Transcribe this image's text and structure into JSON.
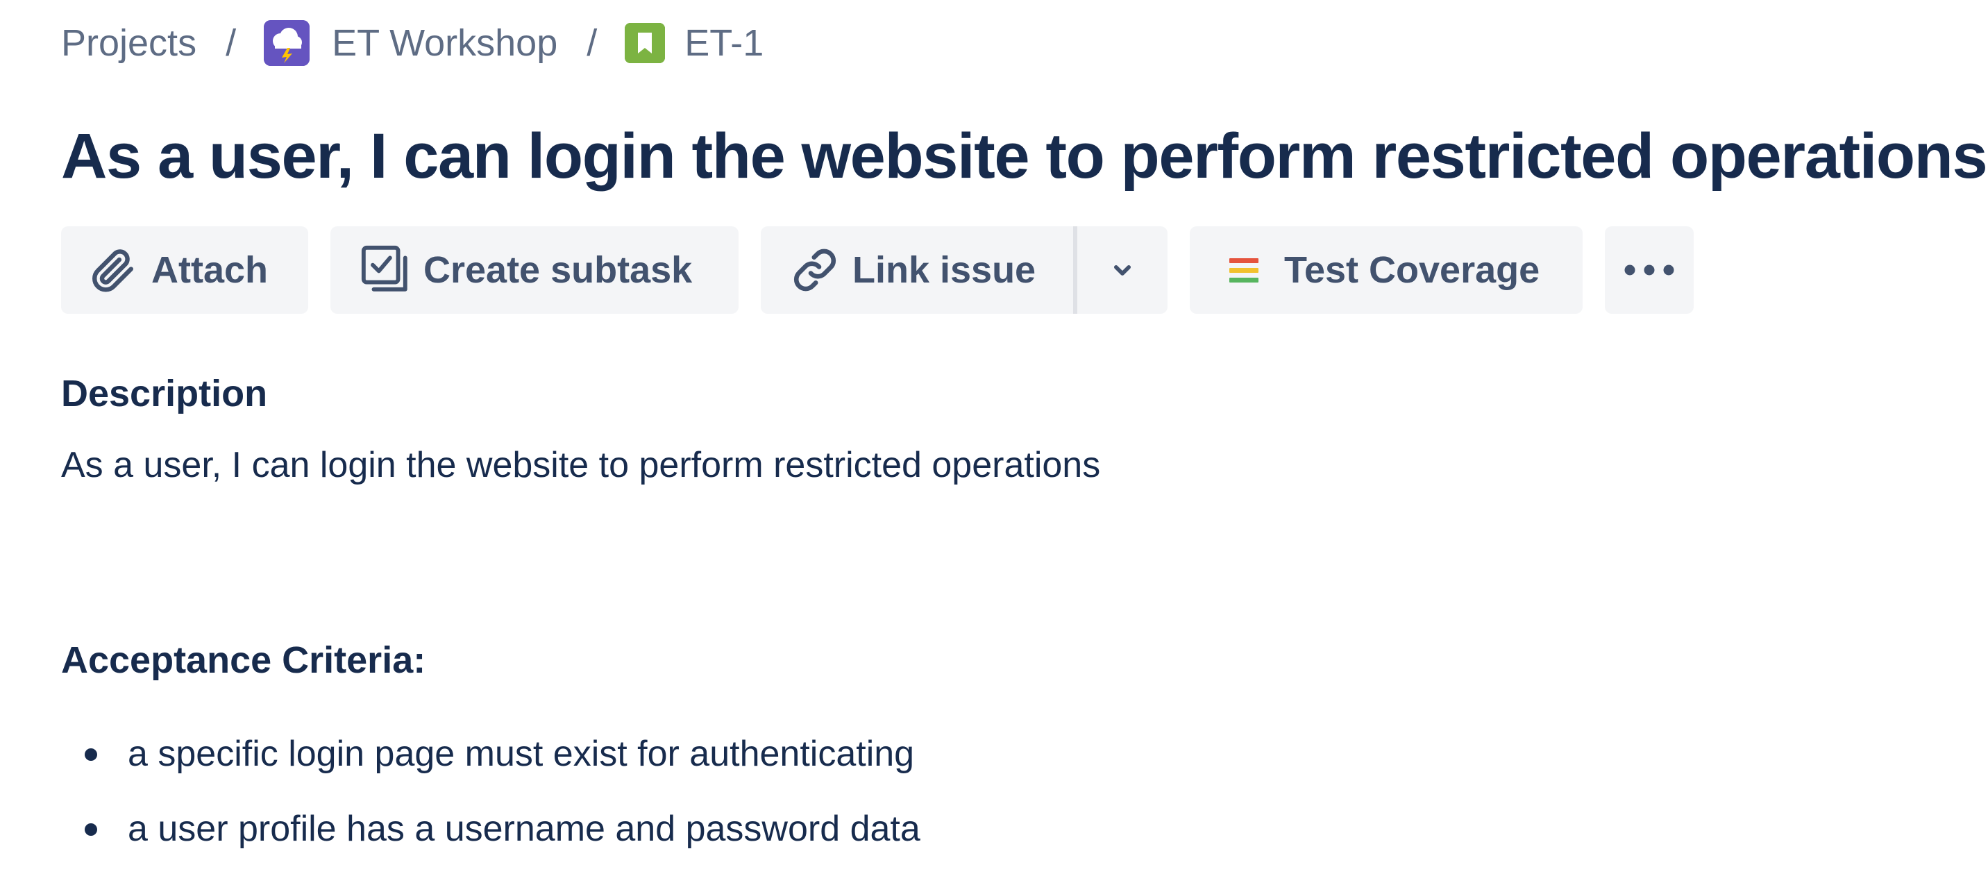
{
  "breadcrumb": {
    "projects": "Projects",
    "separator": "/",
    "project_name": "ET Workshop",
    "issue_key": "ET-1"
  },
  "issue": {
    "title": "As a user, I can login the website to perform restricted operations"
  },
  "toolbar": {
    "attach_label": "Attach",
    "create_subtask_label": "Create subtask",
    "link_issue_label": "Link issue",
    "test_coverage_label": "Test Coverage",
    "more_label": "•••"
  },
  "description": {
    "heading": "Description",
    "text": "As a user, I can login the website to perform restricted operations",
    "acceptance_heading": "Acceptance Criteria:",
    "criteria": [
      "a specific login page must exist for authenticating",
      "a user profile has a username and password data"
    ]
  },
  "icons": {
    "project_avatar": "storm-cloud-icon",
    "issue_type": "story-bookmark-icon",
    "attach": "paperclip-icon",
    "subtask": "subtask-checkbox-icon",
    "link": "link-chain-icon",
    "dropdown": "chevron-down-icon",
    "coverage": "coverage-bars-icon",
    "more": "more-dots-icon"
  },
  "colors": {
    "text_primary": "#172b4d",
    "text_secondary": "#5e6c84",
    "button_bg": "#f4f5f7",
    "project_avatar": "#6554c0",
    "story_icon": "#7cb342",
    "coverage_red": "#e5533d",
    "coverage_yellow": "#f2c12e",
    "coverage_green": "#57b55f"
  }
}
